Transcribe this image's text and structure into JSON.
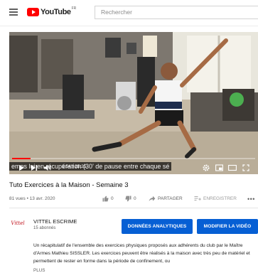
{
  "header": {
    "logo_text": "YouTube",
    "logo_country": "FR",
    "search_placeholder": "Rechercher"
  },
  "player": {
    "caption": "emps lui en récupération (30' de pause entre chaque sé",
    "time": "1:54 / 25:25",
    "progress": 0.075,
    "accent_color": "#ff0000"
  },
  "video": {
    "title": "Tuto Exercices à la Maison - Semaine 3",
    "meta": "81 vues • 13 avr. 2020",
    "likes": "0",
    "dislikes": "0",
    "share_label": "PARTAGER",
    "save_label": "ENREGISTRER",
    "more_icon": "more-horizontal-icon"
  },
  "channel": {
    "avatar_text": "Vittel",
    "name": "VITTEL ESCRIME",
    "subscribers": "15 abonnés",
    "analytics_label": "DONNÉES ANALYTIQUES",
    "edit_label": "MODIFIER LA VIDÉO",
    "button_color": "#065fd4"
  },
  "description": {
    "text": "Un récapitulatif de l'ensemble des exercices physiques proposés aux adhérents du club par le Maître d'Armes Mathieu SISSLER. Les exercices peuvent être réalisés à la maison avec très peu de matériel et permettent de rester en forme dans la période de confinement, ou",
    "show_more": "PLUS"
  }
}
